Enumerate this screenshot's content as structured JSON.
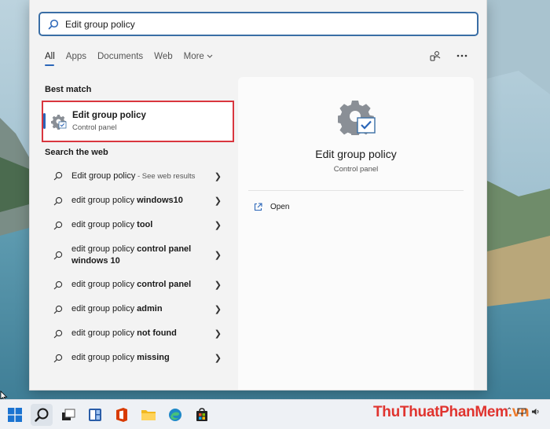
{
  "search": {
    "value": "Edit group policy"
  },
  "tabs": [
    {
      "label": "All"
    },
    {
      "label": "Apps"
    },
    {
      "label": "Documents"
    },
    {
      "label": "Web"
    },
    {
      "label": "More"
    }
  ],
  "sections": {
    "best_match": "Best match",
    "search_web": "Search the web"
  },
  "best_match_item": {
    "title": "Edit group policy",
    "subtitle": "Control panel"
  },
  "web_results": [
    {
      "prefix": "Edit group policy",
      "bold": "",
      "hint": " - See web results"
    },
    {
      "prefix": "edit group policy ",
      "bold": "windows10",
      "hint": ""
    },
    {
      "prefix": "edit group policy ",
      "bold": "tool",
      "hint": ""
    },
    {
      "prefix": "edit group policy ",
      "bold": "control panel windows 10",
      "hint": ""
    },
    {
      "prefix": "edit group policy ",
      "bold": "control panel",
      "hint": ""
    },
    {
      "prefix": "edit group policy ",
      "bold": "admin",
      "hint": ""
    },
    {
      "prefix": "edit group policy ",
      "bold": "not found",
      "hint": ""
    },
    {
      "prefix": "edit group policy ",
      "bold": "missing",
      "hint": ""
    }
  ],
  "preview": {
    "title": "Edit group policy",
    "subtitle": "Control panel",
    "actions": [
      {
        "label": "Open",
        "icon": "open-external-icon"
      }
    ]
  },
  "watermark": {
    "part1": "ThuThuat",
    "part2": "PhanMem",
    "part3": ".vn"
  },
  "taskbar": {
    "icons": [
      "windows-start-icon",
      "search-icon",
      "task-view-icon",
      "widgets-icon",
      "office-icon",
      "file-explorer-icon",
      "edge-icon",
      "store-icon"
    ]
  },
  "colors": {
    "accent": "#2b66b8",
    "highlight_border": "#d9363e",
    "watermark_red": "#e0342f",
    "watermark_orange": "#f07a28"
  }
}
